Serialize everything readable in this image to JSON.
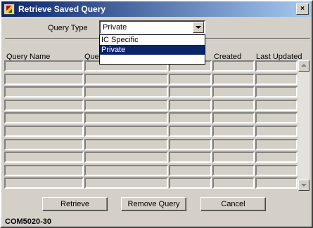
{
  "window": {
    "title": "Retrieve Saved Query",
    "close_glyph": "×"
  },
  "query_type": {
    "label": "Query Type",
    "selected": "Private",
    "options": [
      "IC Specific",
      "Private"
    ]
  },
  "table": {
    "headers": [
      "Query Name",
      "Query Description",
      "",
      "Created",
      "Last Updated"
    ],
    "row_count": 10
  },
  "buttons": {
    "retrieve": "Retrieve",
    "remove": "Remove Query",
    "cancel": "Cancel"
  },
  "status_code": "COM5020-30",
  "icons": [
    "app-icon",
    "close-icon",
    "dropdown-arrow-icon",
    "scroll-up-icon",
    "scroll-down-icon"
  ]
}
